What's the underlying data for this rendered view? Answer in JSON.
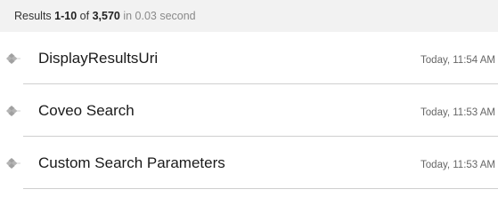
{
  "summary": {
    "prefix": "Results ",
    "range": "1-10",
    "of": " of ",
    "total": "3,570",
    "time": " in 0.03 second"
  },
  "results": [
    {
      "title": "DisplayResultsUri",
      "date": "Today, 11:54 AM",
      "icon": "diamond-bullet-icon"
    },
    {
      "title": "Coveo Search",
      "date": "Today, 11:53 AM",
      "icon": "diamond-bullet-icon"
    },
    {
      "title": "Custom Search Parameters",
      "date": "Today, 11:53 AM",
      "icon": "diamond-bullet-icon"
    }
  ],
  "colors": {
    "summary_background": "#f2f2f2",
    "divider": "#cfcfcf",
    "icon_gray": "#a0a0a0"
  }
}
